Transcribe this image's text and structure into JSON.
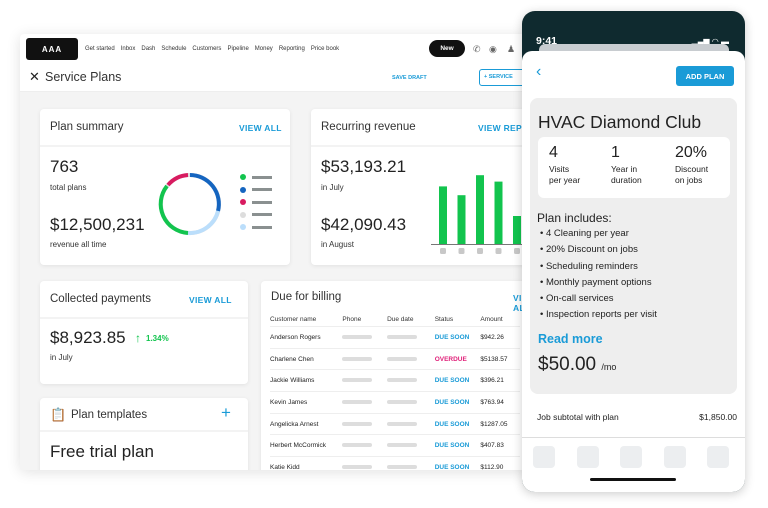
{
  "nav": {
    "logo": "AAA PLUMBING INC",
    "items": [
      "Get started",
      "Inbox",
      "Dash",
      "Schedule",
      "Customers",
      "Pipeline",
      "Money",
      "Reporting",
      "Price book"
    ],
    "new_label": "New"
  },
  "header": {
    "title": "Service Plans",
    "save_draft": "SAVE DRAFT",
    "service_button": "SERVICE"
  },
  "plan_summary": {
    "title": "Plan summary",
    "link": "VIEW ALL",
    "total": "763",
    "total_label": "total plans",
    "revenue": "$12,500,231",
    "revenue_label": "revenue all time",
    "legend_colors": [
      "#12c44e",
      "#1565c0",
      "#d81b60",
      "#dddddd",
      "#bbdefb"
    ]
  },
  "recurring": {
    "title": "Recurring revenue",
    "link": "VIEW REPORT",
    "july": "$53,193.21",
    "july_label": "in July",
    "august": "$42,090.43",
    "august_label": "in August",
    "bar_levels": [
      0.72,
      0.61,
      0.86,
      0.78,
      0.35,
      1.0
    ],
    "bar_color": "#12c44e"
  },
  "collected": {
    "title": "Collected payments",
    "link": "VIEW ALL",
    "amount": "$8,923.85",
    "change": "1.34%",
    "period": "in July"
  },
  "templates": {
    "title": "Plan templates",
    "first": "Free trial plan"
  },
  "billing": {
    "title": "Due for billing",
    "link": "VIEW ALL",
    "columns": [
      "Customer name",
      "Phone",
      "Due date",
      "Status",
      "Amount"
    ],
    "rows": [
      [
        "Anderson Rogers",
        "DUE SOON",
        "$942.26"
      ],
      [
        "Charlene Chen",
        "OVERDUE",
        "$5138.57"
      ],
      [
        "Jackie Williams",
        "DUE SOON",
        "$396.21"
      ],
      [
        "Kevin James",
        "DUE SOON",
        "$763.94"
      ],
      [
        "Angelicka Arnest",
        "DUE SOON",
        "$1287.05"
      ],
      [
        "Herbert McCormick",
        "DUE SOON",
        "$407.83"
      ],
      [
        "Katie Kidd",
        "DUE SOON",
        "$112.90"
      ]
    ]
  },
  "phone": {
    "time": "9:41",
    "add_plan": "ADD PLAN",
    "plan_name": "HVAC Diamond Club",
    "stats": [
      {
        "n": "4",
        "l1": "Visits",
        "l2": "per year"
      },
      {
        "n": "1",
        "l1": "Year in",
        "l2": "duration"
      },
      {
        "n": "20%",
        "l1": "Discount",
        "l2": "on jobs"
      }
    ],
    "includes_title": "Plan includes:",
    "includes": [
      "4 Cleaning per year",
      "20% Discount on jobs",
      "Scheduling reminders",
      "Monthly payment options",
      "On-call services",
      "Inspection reports per visit"
    ],
    "read_more": "Read more",
    "price": "$50.00",
    "price_unit": "/mo",
    "subtotal_label": "Job subtotal with plan",
    "subtotal": "$1,850.00"
  }
}
